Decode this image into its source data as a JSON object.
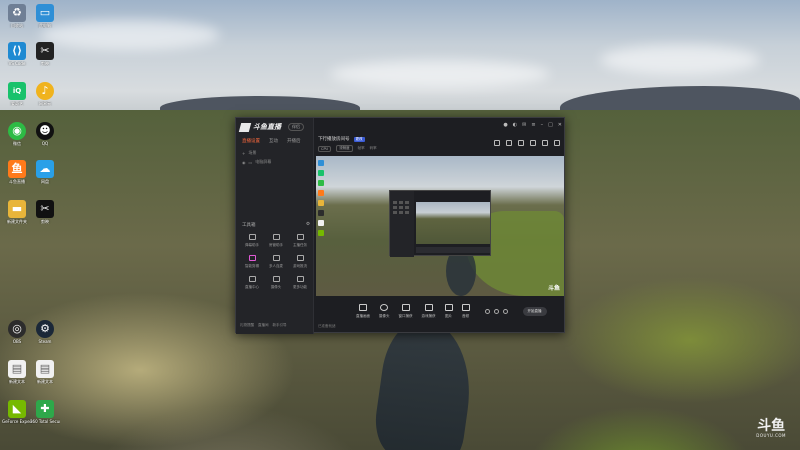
{
  "desktop_icons": [
    {
      "label": "回收站",
      "icon": "recycle-bin-icon",
      "color": "#6f7f95"
    },
    {
      "label": "此电脑",
      "icon": "computer-icon",
      "color": "#2f8fd6"
    },
    {
      "label": "VS Code",
      "icon": "vscode-icon",
      "color": "#1f8ad2"
    },
    {
      "label": "剪映",
      "icon": "jianying-icon",
      "color": "#222222"
    },
    {
      "label": "爱奇艺",
      "icon": "iqiyi-icon",
      "color": "#19c26b"
    },
    {
      "label": "网易云",
      "icon": "music-icon",
      "color": "#f0b31e"
    },
    {
      "label": "微信",
      "icon": "wechat-icon",
      "color": "#2dbb45"
    },
    {
      "label": "QQ",
      "icon": "qq-icon",
      "color": "#111111"
    },
    {
      "label": "斗鱼直播",
      "icon": "douyu-icon",
      "color": "#ff7a1a"
    },
    {
      "label": "网盘",
      "icon": "cloud-icon",
      "color": "#2aa0e8"
    },
    {
      "label": "新建文件夹",
      "icon": "folder-icon",
      "color": "#e8b53a"
    },
    {
      "label": "剪映",
      "icon": "capcut-icon",
      "color": "#111111"
    },
    {
      "label": "OBS",
      "icon": "obs-icon",
      "color": "#2c2c2c"
    },
    {
      "label": "Steam",
      "icon": "steam-icon",
      "color": "#1b2838"
    },
    {
      "label": "新建文本",
      "icon": "document-icon",
      "color": "#f1f1f1"
    },
    {
      "label": "新建文本",
      "icon": "document-icon",
      "color": "#f1f1f1"
    },
    {
      "label": "GeForce Experience",
      "icon": "nvidia-icon",
      "color": "#76b900"
    },
    {
      "label": "360 Total Security",
      "icon": "security-icon",
      "color": "#2ea84a"
    }
  ],
  "app": {
    "logo_text": "斗鱼直播",
    "version": "伴侣",
    "tabs": [
      "直播设置",
      "互动",
      "开播后"
    ],
    "side_rows": [
      "场景",
      "电脑屏幕"
    ],
    "tools_title": "工具箱",
    "tools": [
      "弹幕助手",
      "房管助手",
      "主播任务",
      "智能剪辑",
      "多人连麦",
      "游戏推流",
      "直播中心",
      "摄像头",
      "更多功能"
    ],
    "side_footer": [
      "礼物提醒",
      "直播间",
      "新手引导"
    ],
    "room_title": "下行播放房间号",
    "room_badge": "更改",
    "room_meta": [
      "CPU",
      "流畅度",
      "帧率",
      "码率"
    ],
    "controls": [
      "直播画面",
      "摄像头",
      "窗口捕获",
      "游戏捕获",
      "图片",
      "音频"
    ],
    "start_label": "开始直播",
    "footer_note": "已准备就绪"
  },
  "watermark": {
    "big": "斗鱼",
    "small": "DOUYU.COM"
  },
  "colors": {
    "accent": "#ff6a3d",
    "app_bg": "#1d1e22"
  }
}
